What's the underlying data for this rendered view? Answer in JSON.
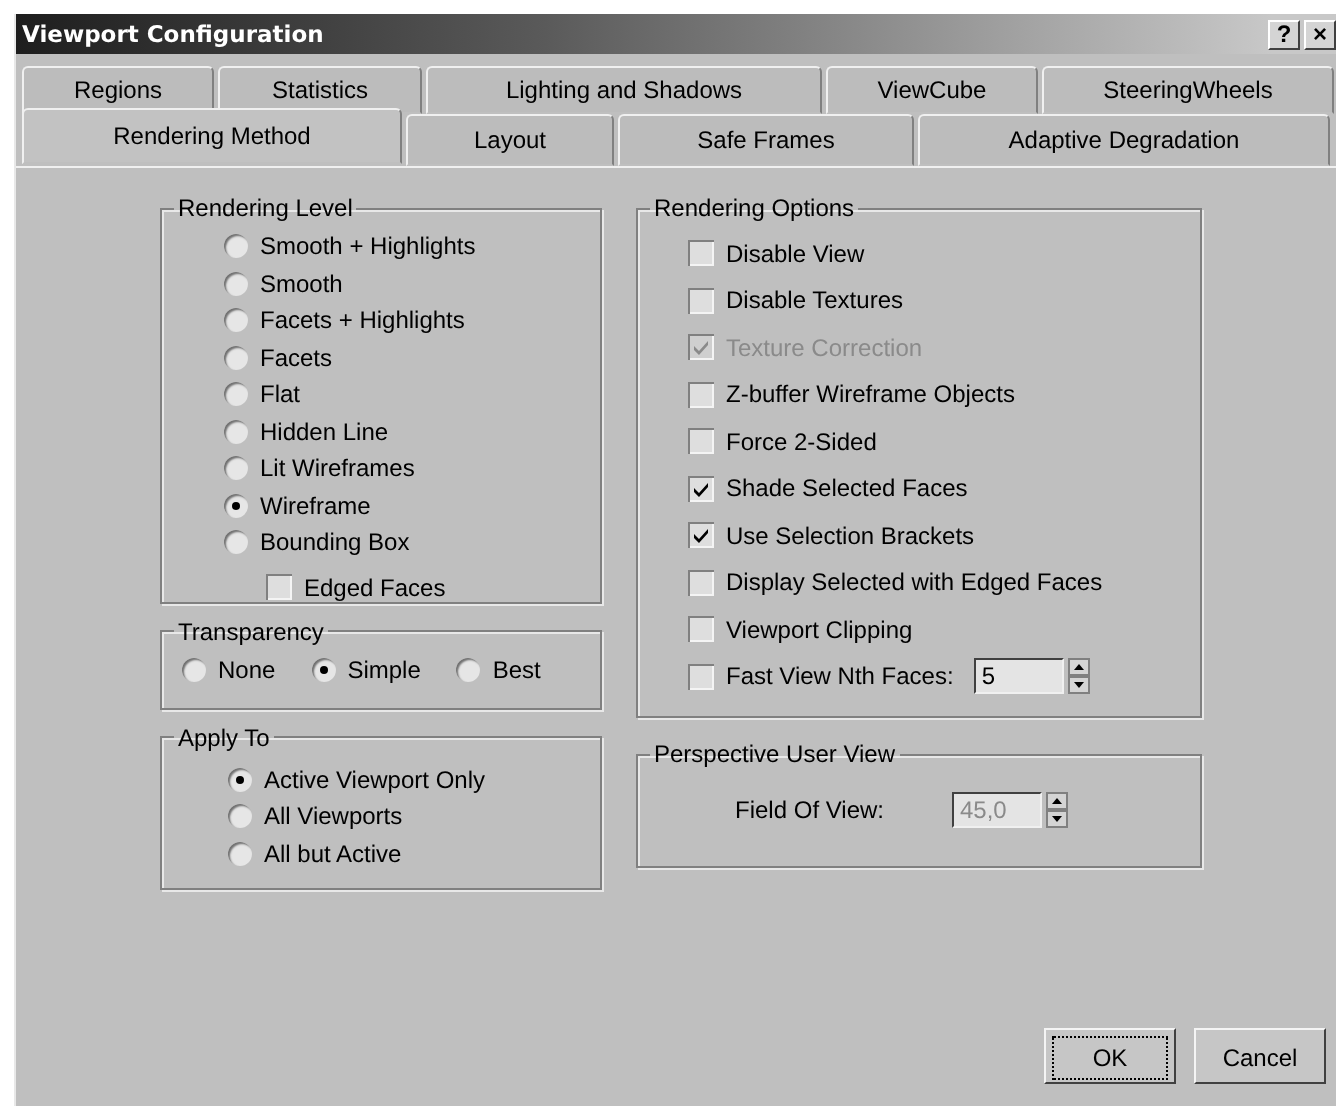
{
  "window": {
    "title": "Viewport Configuration",
    "title_buttons": [
      "?",
      "×"
    ]
  },
  "tab_rows": [
    [
      {
        "label": "Regions",
        "selected": false
      },
      {
        "label": "Statistics",
        "selected": false
      },
      {
        "label": "Lighting and Shadows",
        "selected": false
      },
      {
        "label": "ViewCube",
        "selected": false
      },
      {
        "label": "SteeringWheels",
        "selected": false
      }
    ],
    [
      {
        "label": "Rendering Method",
        "selected": true
      },
      {
        "label": "Layout",
        "selected": false
      },
      {
        "label": "Safe Frames",
        "selected": false
      },
      {
        "label": "Adaptive Degradation",
        "selected": false
      }
    ]
  ],
  "rendering_level": {
    "title": "Rendering Level",
    "options": [
      {
        "label": "Smooth + Highlights",
        "selected": false
      },
      {
        "label": "Smooth",
        "selected": false
      },
      {
        "label": "Facets + Highlights",
        "selected": false
      },
      {
        "label": "Facets",
        "selected": false
      },
      {
        "label": "Flat",
        "selected": false
      },
      {
        "label": "Hidden Line",
        "selected": false
      },
      {
        "label": "Lit Wireframes",
        "selected": false
      },
      {
        "label": "Wireframe",
        "selected": true
      },
      {
        "label": "Bounding Box",
        "selected": false
      }
    ],
    "edged_faces": {
      "label": "Edged Faces",
      "checked": false
    }
  },
  "transparency": {
    "title": "Transparency",
    "options": [
      {
        "label": "None",
        "selected": false
      },
      {
        "label": "Simple",
        "selected": true
      },
      {
        "label": "Best",
        "selected": false
      }
    ]
  },
  "apply_to": {
    "title": "Apply To",
    "options": [
      {
        "label": "Active Viewport Only",
        "selected": true
      },
      {
        "label": "All Viewports",
        "selected": false
      },
      {
        "label": "All but Active",
        "selected": false
      }
    ]
  },
  "rendering_options": {
    "title": "Rendering Options",
    "items": [
      {
        "label": "Disable View",
        "checked": false,
        "disabled": false
      },
      {
        "label": "Disable Textures",
        "checked": false,
        "disabled": false
      },
      {
        "label": "Texture Correction",
        "checked": true,
        "disabled": true
      },
      {
        "label": "Z-buffer Wireframe Objects",
        "checked": false,
        "disabled": false
      },
      {
        "label": "Force 2-Sided",
        "checked": false,
        "disabled": false
      },
      {
        "label": "Shade Selected Faces",
        "checked": true,
        "disabled": false
      },
      {
        "label": "Use Selection Brackets",
        "checked": true,
        "disabled": false
      },
      {
        "label": "Display Selected with Edged Faces",
        "checked": false,
        "disabled": false
      },
      {
        "label": "Viewport Clipping",
        "checked": false,
        "disabled": false
      }
    ],
    "fast_view": {
      "label": "Fast View Nth Faces:",
      "checked": false,
      "value": "5",
      "disabled": false
    }
  },
  "perspective_user_view": {
    "title": "Perspective User View",
    "field_of_view": {
      "label": "Field Of View:",
      "value": "45,0",
      "disabled": true
    }
  },
  "buttons": [
    {
      "label": "OK",
      "focused": true
    },
    {
      "label": "Cancel",
      "focused": false
    }
  ]
}
